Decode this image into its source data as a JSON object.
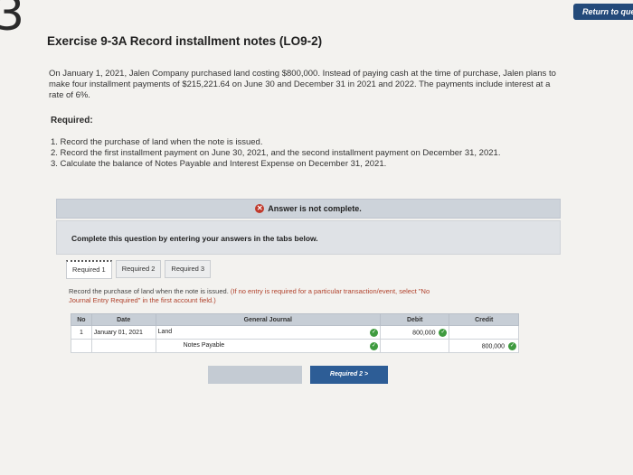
{
  "page_marker": "3",
  "return_button": "Return to que",
  "title": "Exercise 9-3A Record installment notes (LO9-2)",
  "intro_lines": [
    "On January 1, 2021, Jalen Company purchased land costing $800,000. Instead of paying cash at the time of purchase, Jalen plans to",
    "make four installment payments of $215,221.64 on June 30 and December 31 in 2021 and 2022. The payments include interest at a",
    "rate of 6%."
  ],
  "required_label": "Required:",
  "requirements": [
    "1. Record the purchase of land when the note is issued.",
    "2. Record the first installment payment on June 30, 2021, and the second installment payment on December 31, 2021.",
    "3. Calculate the balance of Notes Payable and Interest Expense on December 31, 2021."
  ],
  "banner_text": "Answer is not complete.",
  "panel_text": "Complete this question by entering your answers in the tabs below.",
  "tabs": [
    "Required 1",
    "Required 2",
    "Required 3"
  ],
  "instruction_main": "Record the purchase of land when the note is issued.",
  "instruction_note_1": "(If no entry is required for a particular transaction/event, select \"No",
  "instruction_note_2": "Journal Entry Required\" in the first account field.)",
  "table": {
    "headers": [
      "No",
      "Date",
      "General Journal",
      "Debit",
      "Credit"
    ],
    "rows": [
      {
        "no": "1",
        "date": "January 01, 2021",
        "account": "Land",
        "debit": "800,000",
        "credit": ""
      },
      {
        "no": "",
        "date": "",
        "account": "Notes Payable",
        "debit": "",
        "credit": "800,000"
      }
    ]
  },
  "nav_prev": "",
  "nav_next": "Required 2  >",
  "colors": {
    "nav_next": "#2d5d96",
    "check": "#3f9b3f",
    "error": "#c0392b"
  }
}
